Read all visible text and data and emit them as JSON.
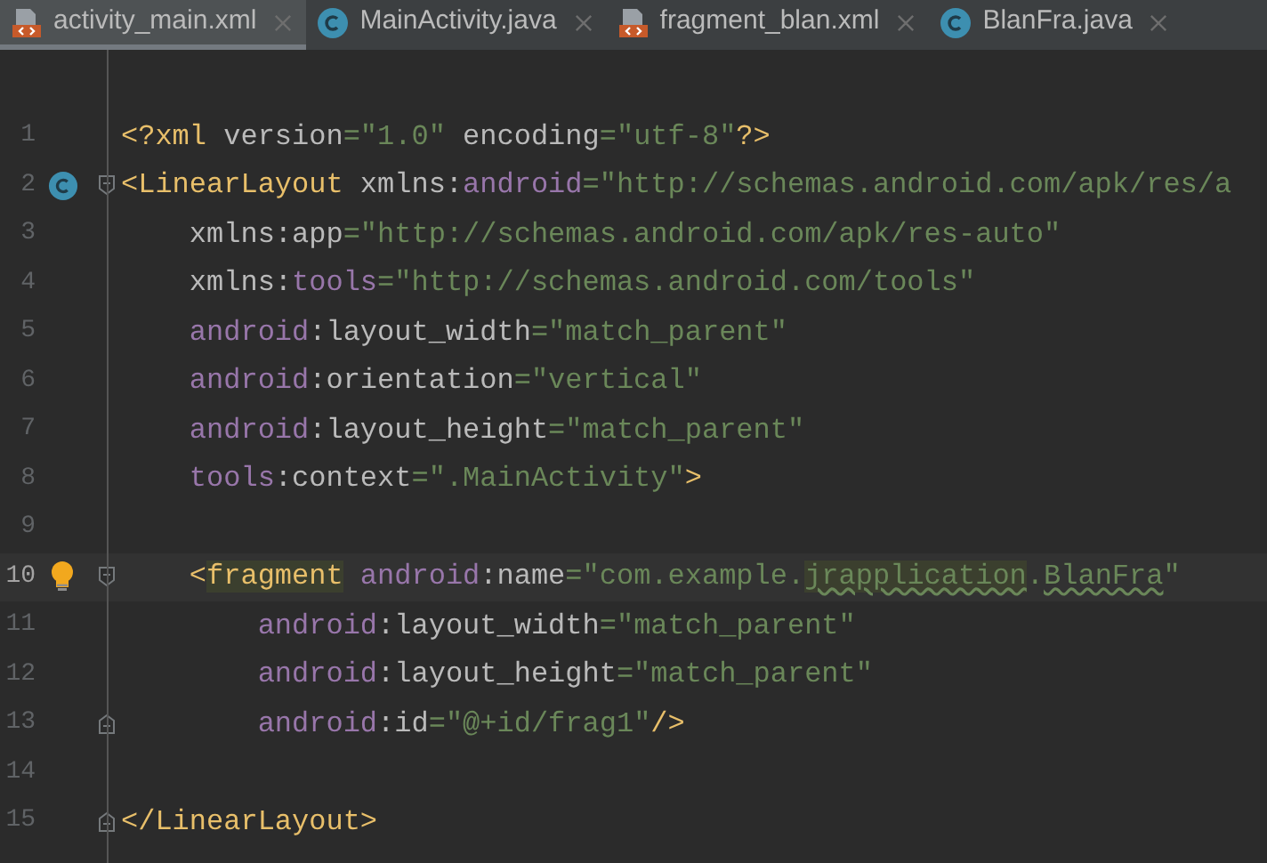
{
  "tabs": [
    {
      "label": "activity_main.xml",
      "kind": "xml",
      "selected": true
    },
    {
      "label": "MainActivity.java",
      "kind": "class",
      "selected": false
    },
    {
      "label": "fragment_blan.xml",
      "kind": "xml",
      "selected": false
    },
    {
      "label": "BlanFra.java",
      "kind": "class",
      "selected": false
    }
  ],
  "lines": [
    {
      "number": "1",
      "current": false,
      "tokens": [
        {
          "kind": "tag",
          "text": "<?xml "
        },
        {
          "kind": "attr",
          "text": "version"
        },
        {
          "kind": "string",
          "text": "=\"1.0\" "
        },
        {
          "kind": "attr",
          "text": "encoding"
        },
        {
          "kind": "string",
          "text": "=\"utf-8\""
        },
        {
          "kind": "tag",
          "text": "?>"
        }
      ]
    },
    {
      "number": "2",
      "current": false,
      "gutter_mark": {
        "kind": "class"
      },
      "fold_mark": {
        "kind": "start"
      },
      "tokens": [
        {
          "kind": "tag",
          "text": "<LinearLayout "
        },
        {
          "kind": "attr",
          "text": "xmlns:"
        },
        {
          "kind": "ns",
          "text": "android"
        },
        {
          "kind": "string",
          "text": "=\"http://schemas.android.com/apk/res/a"
        }
      ]
    },
    {
      "number": "3",
      "current": false,
      "tokens": [
        {
          "kind": "attr",
          "text": "    xmlns:app"
        },
        {
          "kind": "string",
          "text": "=\"http://schemas.android.com/apk/res-auto\""
        }
      ]
    },
    {
      "number": "4",
      "current": false,
      "tokens": [
        {
          "kind": "attr",
          "text": "    xmlns:"
        },
        {
          "kind": "ns",
          "text": "tools"
        },
        {
          "kind": "string",
          "text": "=\"http://schemas.android.com/tools\""
        }
      ]
    },
    {
      "number": "5",
      "current": false,
      "tokens": [
        {
          "kind": "ns",
          "text": "    android"
        },
        {
          "kind": "attr",
          "text": ":layout_width"
        },
        {
          "kind": "string",
          "text": "=\"match_parent\""
        }
      ]
    },
    {
      "number": "6",
      "current": false,
      "tokens": [
        {
          "kind": "ns",
          "text": "    android"
        },
        {
          "kind": "attr",
          "text": ":orientation"
        },
        {
          "kind": "string",
          "text": "=\"vertical\""
        }
      ]
    },
    {
      "number": "7",
      "current": false,
      "tokens": [
        {
          "kind": "ns",
          "text": "    android"
        },
        {
          "kind": "attr",
          "text": ":layout_height"
        },
        {
          "kind": "string",
          "text": "=\"match_parent\""
        }
      ]
    },
    {
      "number": "8",
      "current": false,
      "tokens": [
        {
          "kind": "ns",
          "text": "    tools"
        },
        {
          "kind": "attr",
          "text": ":context"
        },
        {
          "kind": "string",
          "text": "=\".MainActivity\""
        },
        {
          "kind": "tag",
          "text": ">"
        }
      ]
    },
    {
      "number": "9",
      "current": false
    },
    {
      "number": "10",
      "current": true,
      "gutter_mark": {
        "kind": "bulb"
      },
      "fold_mark": {
        "kind": "start"
      },
      "tokens": [
        {
          "kind": "tag",
          "text": "    <"
        },
        {
          "kind": "tag",
          "text": "fragment",
          "highlight": true
        },
        {
          "kind": "ns",
          "text": " android"
        },
        {
          "kind": "attr",
          "text": ":name"
        },
        {
          "kind": "string",
          "text": "=\"com.example."
        },
        {
          "kind": "string",
          "text": "jrapplication",
          "highlight": true,
          "typo": true
        },
        {
          "kind": "string",
          "text": "."
        },
        {
          "kind": "string",
          "text": "BlanFra",
          "typo": true
        },
        {
          "kind": "string",
          "text": "\""
        }
      ]
    },
    {
      "number": "11",
      "current": false,
      "tokens": [
        {
          "kind": "ns",
          "text": "        android"
        },
        {
          "kind": "attr",
          "text": ":layout_width"
        },
        {
          "kind": "string",
          "text": "=\"match_parent\""
        }
      ]
    },
    {
      "number": "12",
      "current": false,
      "tokens": [
        {
          "kind": "ns",
          "text": "        android"
        },
        {
          "kind": "attr",
          "text": ":layout_height"
        },
        {
          "kind": "string",
          "text": "=\"match_parent\""
        }
      ]
    },
    {
      "number": "13",
      "current": false,
      "fold_mark": {
        "kind": "end"
      },
      "tokens": [
        {
          "kind": "ns",
          "text": "        android"
        },
        {
          "kind": "attr",
          "text": ":id"
        },
        {
          "kind": "string",
          "text": "=\"@+id/frag1\""
        },
        {
          "kind": "tag",
          "text": "/>"
        }
      ]
    },
    {
      "number": "14",
      "current": false
    },
    {
      "number": "15",
      "current": false,
      "fold_mark": {
        "kind": "end"
      },
      "tokens": [
        {
          "kind": "tag",
          "text": "</LinearLayout>"
        }
      ]
    }
  ]
}
